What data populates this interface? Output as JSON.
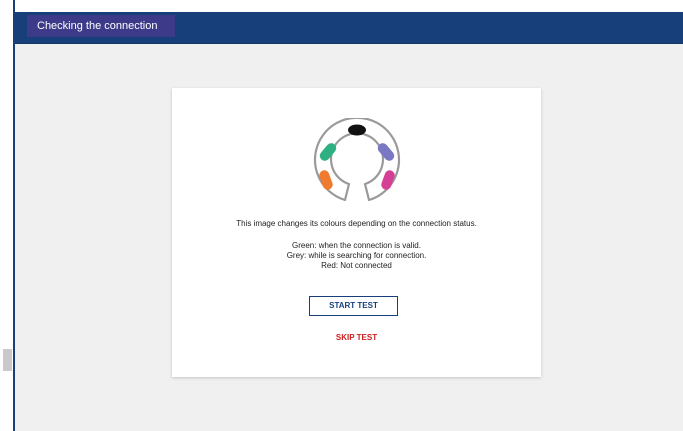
{
  "window": {
    "title": "Checking the connection"
  },
  "card": {
    "description": "This image changes its colours depending on the connection status.",
    "status_lines": [
      "Green: when the connection is valid.",
      "Grey:  while is searching for connection.",
      "Red:  Not connected"
    ],
    "start_label": "START TEST",
    "skip_label": "SKIP TEST"
  },
  "status_image": {
    "icon": "connection-ring-icon",
    "segment_colors": {
      "top": "#111111",
      "upper_left": "#2fb083",
      "lower_left": "#f07a2e",
      "upper_right": "#7a78c4",
      "lower_right": "#d63f96"
    }
  },
  "colors": {
    "header": "#17407a",
    "title_tab": "#3e3a8a",
    "background": "#f0f0f0",
    "skip": "#cc1f1f"
  }
}
